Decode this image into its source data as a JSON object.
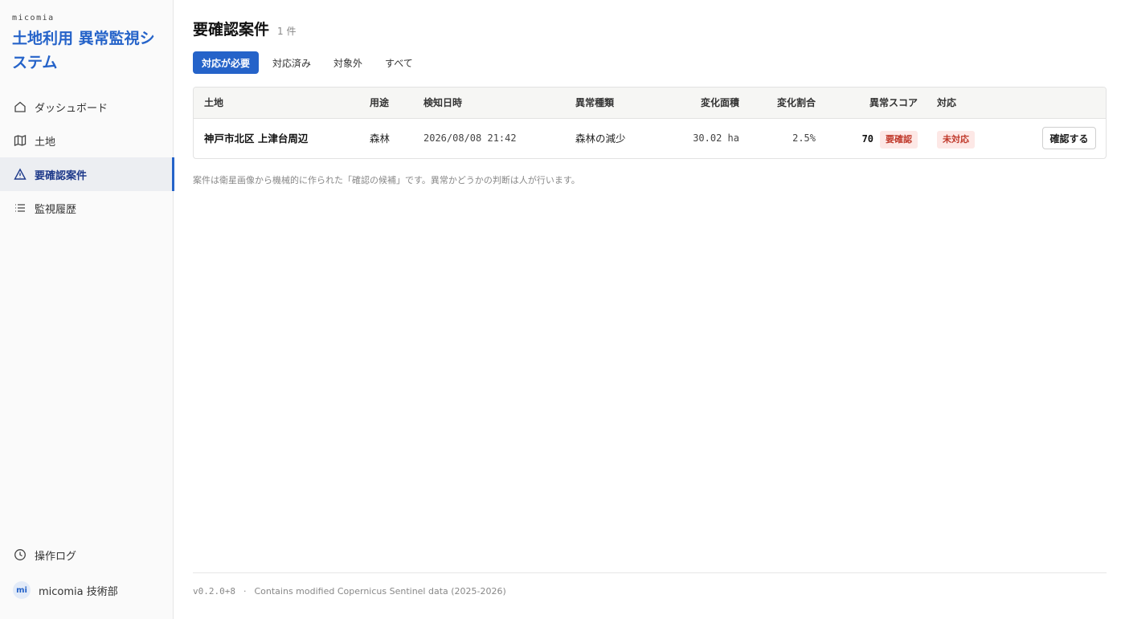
{
  "sidebar": {
    "brand_small": "micomia",
    "brand_title": "土地利用 異常監視システム",
    "nav": [
      {
        "label": "ダッシュボード",
        "icon": "home-icon"
      },
      {
        "label": "土地",
        "icon": "map-icon"
      },
      {
        "label": "要確認案件",
        "icon": "alert-triangle-icon",
        "active": true
      },
      {
        "label": "監視履歴",
        "icon": "list-icon"
      }
    ],
    "oplog_label": "操作ログ",
    "user": {
      "initials": "mi",
      "name": "micomia 技術部"
    }
  },
  "page": {
    "title": "要確認案件",
    "count": "1 件"
  },
  "tabs": [
    {
      "label": "対応が必要",
      "active": true
    },
    {
      "label": "対応済み"
    },
    {
      "label": "対象外"
    },
    {
      "label": "すべて"
    }
  ],
  "table": {
    "headers": [
      "土地",
      "用途",
      "検知日時",
      "異常種類",
      "変化面積",
      "変化割合",
      "異常スコア",
      "対応"
    ],
    "rows": [
      {
        "land": "神戸市北区 上津台周辺",
        "usage": "森林",
        "detected_at": "2026/08/08 21:42",
        "anomaly_type": "森林の減少",
        "area": "30.02 ha",
        "ratio": "2.5%",
        "score": "70",
        "score_badge": "要確認",
        "status": "未対応",
        "action_label": "確認する"
      }
    ]
  },
  "note": "案件は衛星画像から機械的に作られた「確認の候補」です。異常かどうかの判断は人が行います。",
  "footer": {
    "version": "v0.2.0+8",
    "separator": "·",
    "attribution": "Contains modified Copernicus Sentinel data (2025-2026)"
  },
  "colors": {
    "accent": "#2563c9",
    "badge_red": "#c0392b",
    "badge_bg": "#fde8e6"
  }
}
